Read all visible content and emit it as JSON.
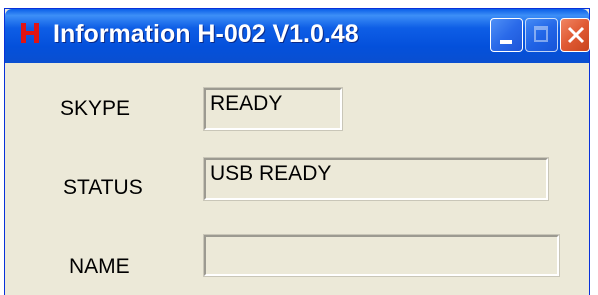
{
  "window": {
    "title": "Information H-002 V1.0.48",
    "app_icon_letter": "H",
    "title_bar_color": "#0a4fd0",
    "close_button_color": "#e05a33"
  },
  "fields": [
    {
      "label": "SKYPE",
      "value": "READY"
    },
    {
      "label": "STATUS",
      "value": "USB READY"
    },
    {
      "label": "NAME",
      "value": ""
    }
  ]
}
